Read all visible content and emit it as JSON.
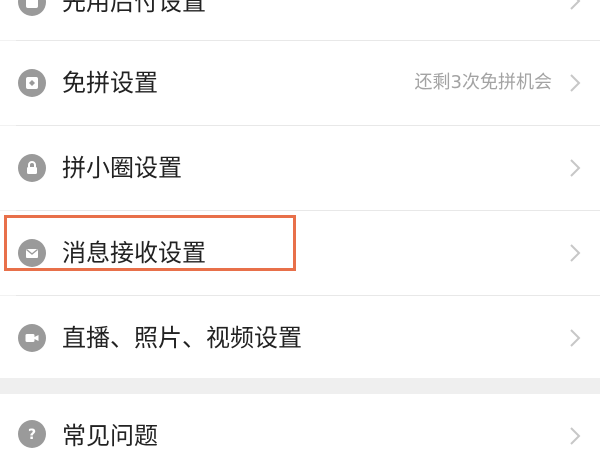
{
  "settings": {
    "items": [
      {
        "id": "sh",
        "label": "先用后付设置",
        "hint": "",
        "icon": "pay-later-icon"
      },
      {
        "id": "mp",
        "label": "免拼设置",
        "hint": "还剩3次免拼机会",
        "icon": "coupon-icon"
      },
      {
        "id": "px",
        "label": "拼小圈设置",
        "hint": "",
        "icon": "lock-icon"
      },
      {
        "id": "xx",
        "label": "消息接收设置",
        "hint": "",
        "icon": "mail-icon"
      },
      {
        "id": "zb",
        "label": "直播、照片、视频设置",
        "hint": "",
        "icon": "camera-icon"
      }
    ],
    "faq": {
      "label": "常见问题",
      "icon": "question-icon"
    }
  },
  "highlight": {
    "color": "#e8704a",
    "target": "消息接收设置"
  }
}
